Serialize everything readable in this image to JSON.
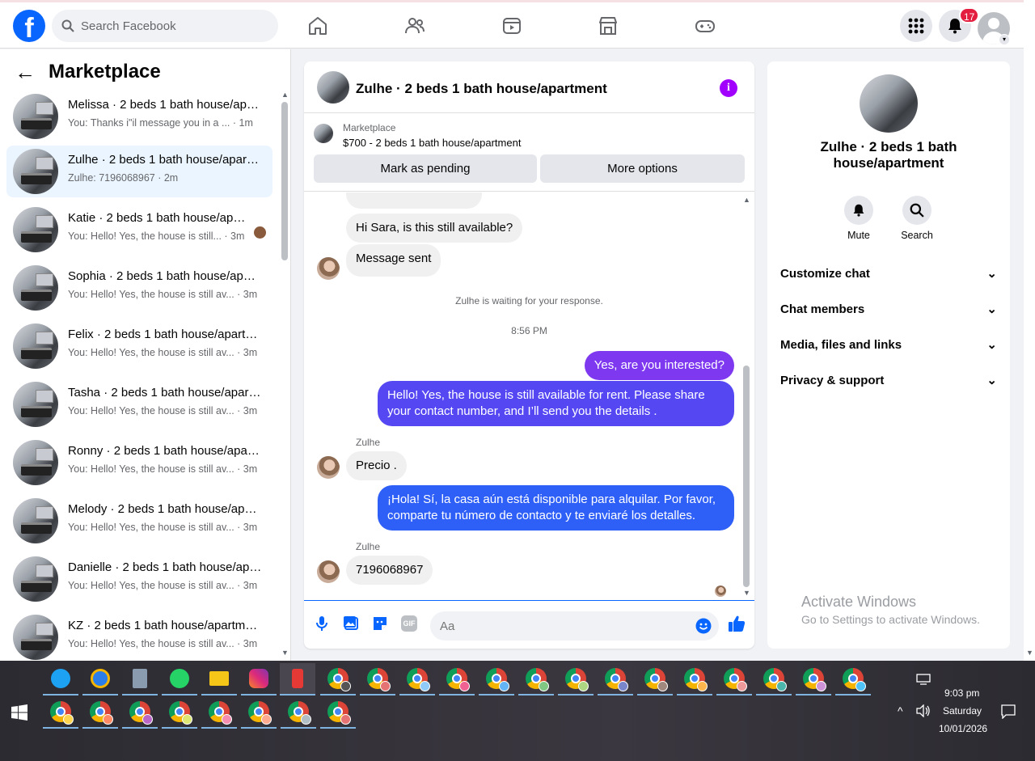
{
  "topbar": {
    "logo_letter": "f",
    "search_placeholder": "Search Facebook",
    "notifications_count": "17"
  },
  "sidebar": {
    "title": "Marketplace",
    "conversations": [
      {
        "name": "Melissa · 2 beds 1 bath house/apartment",
        "preview": "You: Thanks i\"il message you in a ...",
        "time": "· 1m"
      },
      {
        "name": "Zulhe · 2 beds 1 bath house/apartment",
        "preview": "Zulhe: 7196068967",
        "time": "· 2m"
      },
      {
        "name": "Katie · 2 beds 1 bath house/apartment",
        "preview": "You: Hello! Yes, the house is still...",
        "time": "· 3m"
      },
      {
        "name": "Sophia · 2 beds 1 bath house/apartment",
        "preview": "You: Hello! Yes, the house is still av...",
        "time": "· 3m"
      },
      {
        "name": "Felix · 2 beds 1 bath house/apartment",
        "preview": "You: Hello! Yes, the house is still av...",
        "time": "· 3m"
      },
      {
        "name": "Tasha · 2 beds 1 bath house/apartment",
        "preview": "You: Hello! Yes, the house is still av...",
        "time": "· 3m"
      },
      {
        "name": "Ronny · 2 beds 1 bath house/apartment",
        "preview": "You: Hello! Yes, the house is still av...",
        "time": "· 3m"
      },
      {
        "name": "Melody · 2 beds 1 bath house/apartment",
        "preview": "You: Hello! Yes, the house is still av...",
        "time": "· 3m"
      },
      {
        "name": "Danielle · 2 beds 1 bath house/apartment",
        "preview": "You: Hello! Yes, the house is still av...",
        "time": "· 3m"
      },
      {
        "name": "KZ · 2 beds 1 bath house/apartment",
        "preview": "You: Hello! Yes, the house is still av...",
        "time": "· 3m"
      }
    ]
  },
  "chat": {
    "title": "Zulhe · 2 beds 1 bath house/apartment",
    "marketplace_label": "Marketplace",
    "listing": "$700 - 2 beds 1 bath house/apartment",
    "mark_pending": "Mark as pending",
    "more_options": "More options",
    "messages": {
      "m1": "Hi Sara, is this still available?",
      "m2": "Message sent",
      "waiting": "Zulhe is waiting for your response.",
      "time": "8:56 PM",
      "m3": "Yes, are you interested?",
      "m4": "Hello! Yes, the house is still available for rent. Please share your contact number, and I’ll send you the details .",
      "sender1": "Zulhe",
      "m5": "Precio .",
      "m6": "¡Hola! Sí, la casa aún está disponible para alquilar. Por favor, comparte tu número de contacto y te enviaré los detalles.",
      "sender2": "Zulhe",
      "m7": "7196068967"
    },
    "composer_placeholder": "Aa",
    "gif_label": "GIF"
  },
  "details": {
    "name": "Zulhe · 2 beds 1 bath house/apartment",
    "mute": "Mute",
    "search": "Search",
    "rows": [
      "Customize chat",
      "Chat members",
      "Media, files and links",
      "Privacy & support"
    ]
  },
  "watermark": {
    "line1": "Activate Windows",
    "line2": "Go to Settings to activate Windows."
  },
  "taskbar": {
    "time": "9:03 pm",
    "day": "Saturday",
    "date": "10/01/2026"
  },
  "colors": {
    "brand": "#0866ff",
    "bubble_purple": "#7e39f0",
    "bubble_indigo": "#5548f3",
    "bubble_blue": "#2e5ff6",
    "badge_red": "#e41e3f"
  }
}
